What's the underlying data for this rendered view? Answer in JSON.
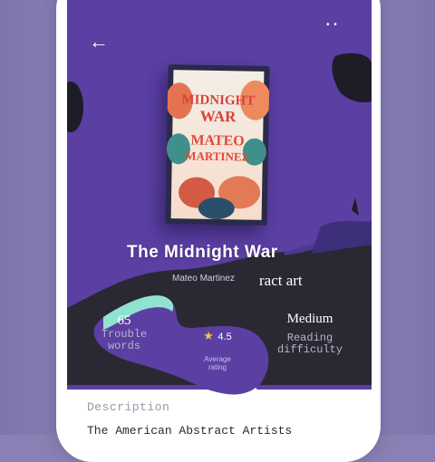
{
  "nav": {
    "back_icon": "arrow-left-icon",
    "more_icon": "more-icon",
    "back_glyph": "←",
    "more_glyph": "• •"
  },
  "book": {
    "cover_title_line1": "MIDNIGHT",
    "cover_title_line2": "WAR",
    "cover_author_line1": "MATEO",
    "cover_author_line2": "MARTINEZ",
    "title": "The Midnight War",
    "author": "Mateo Martinez"
  },
  "subtitle": "ract art",
  "stats": {
    "words": {
      "value": "65",
      "label_line1": "Trouble",
      "label_line2": "words"
    },
    "rating": {
      "value": "4.5",
      "label_line1": "Average",
      "label_line2": "rating",
      "icon": "star-icon"
    },
    "difficulty": {
      "value": "Medium",
      "label_line1": "Reading",
      "label_line2": "difficulty"
    }
  },
  "description": {
    "label": "Description",
    "text": "The American Abstract Artists"
  },
  "colors": {
    "accent_purple": "#5b3fa3",
    "dark_panel": "#2a2833",
    "teal_highlight": "#8fe3d0",
    "star": "#f5c542"
  }
}
